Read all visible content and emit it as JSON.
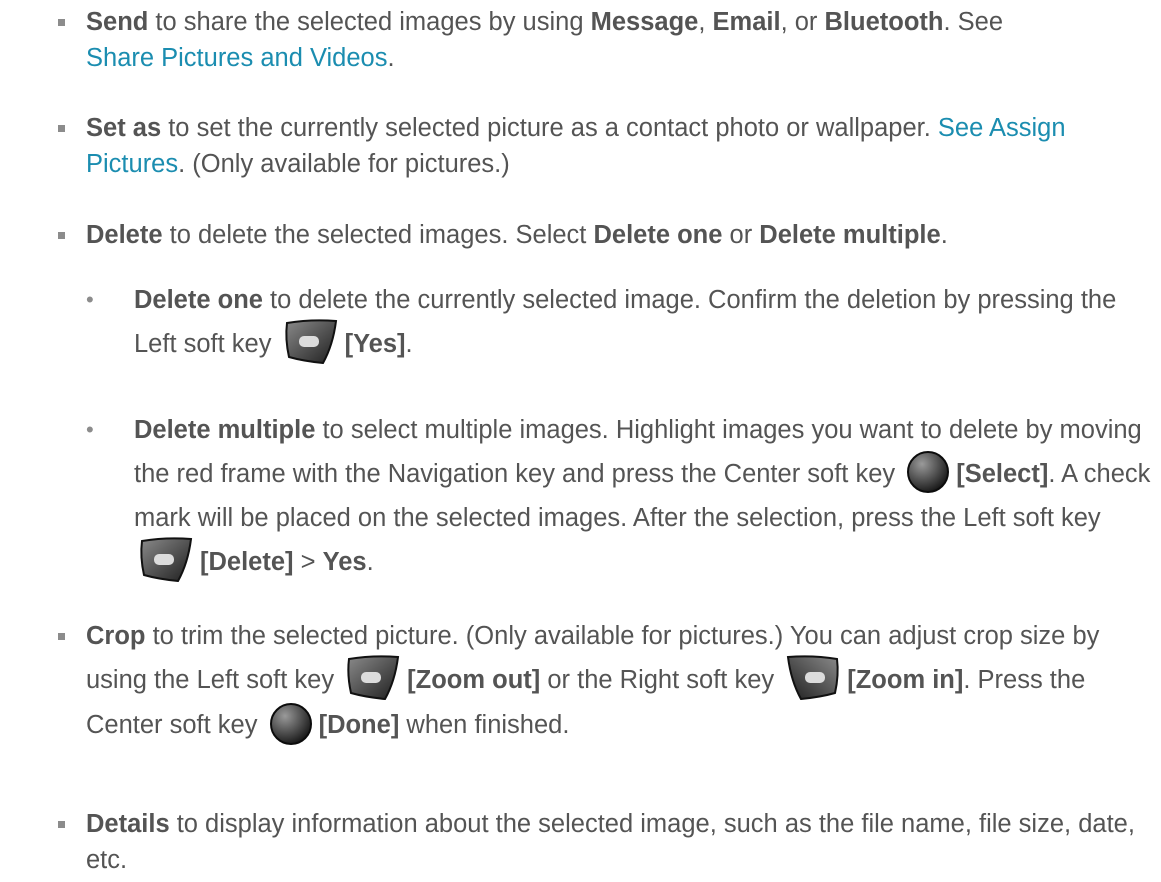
{
  "items": [
    {
      "term": "Send",
      "text1": " to share the selected images by using ",
      "opt1": "Message",
      "sep1": ", ",
      "opt2": "Email",
      "sep2": ", or ",
      "opt3": "Bluetooth",
      "text2": ". See ",
      "link": "Share Pictures and Videos",
      "text3": "."
    },
    {
      "term": "Set as",
      "text1": " to set the currently selected picture as a contact photo or wallpaper. ",
      "link": "See Assign Pictures",
      "text2": ". (Only available for pictures.)"
    },
    {
      "term": "Delete",
      "text1": " to delete the selected images. Select ",
      "opt1": "Delete one",
      "sep1": " or ",
      "opt2": "Delete multiple",
      "text2": "."
    },
    {
      "term": "Crop",
      "text1": " to trim the selected picture. (Only available for pictures.) You can adjust crop size by using the Left soft key ",
      "key1": "[Zoom out]",
      "text2": " or the Right soft key ",
      "key2": "[Zoom in]",
      "text3": ". Press the Center soft key ",
      "key3": "[Done]",
      "text4": " when finished."
    },
    {
      "term": "Details",
      "text1": " to display information about the selected image, such as the file name, file size, date, etc."
    }
  ],
  "subitems": [
    {
      "term": "Delete one",
      "text1": " to delete the currently selected image. Confirm the deletion by pressing the Left soft key ",
      "key1": "[Yes]",
      "text2": "."
    },
    {
      "term": "Delete multiple",
      "text1": " to select multiple images. Highlight images you want to delete by moving the red frame with the Navigation key and press the Center soft key ",
      "key1": "[Select]",
      "text2": ". A check mark will be placed on the selected images. After the selection, press the Left soft key ",
      "key2": "[Delete]",
      "text3": " > ",
      "key3": "Yes",
      "text4": "."
    }
  ],
  "icons": {
    "left_soft_key": "left-soft-key-icon",
    "right_soft_key": "right-soft-key-icon",
    "center_soft_key": "center-soft-key-icon"
  },
  "colors": {
    "text": "#545454",
    "link": "#1b8db0",
    "bullet": "#8c8c8c"
  }
}
